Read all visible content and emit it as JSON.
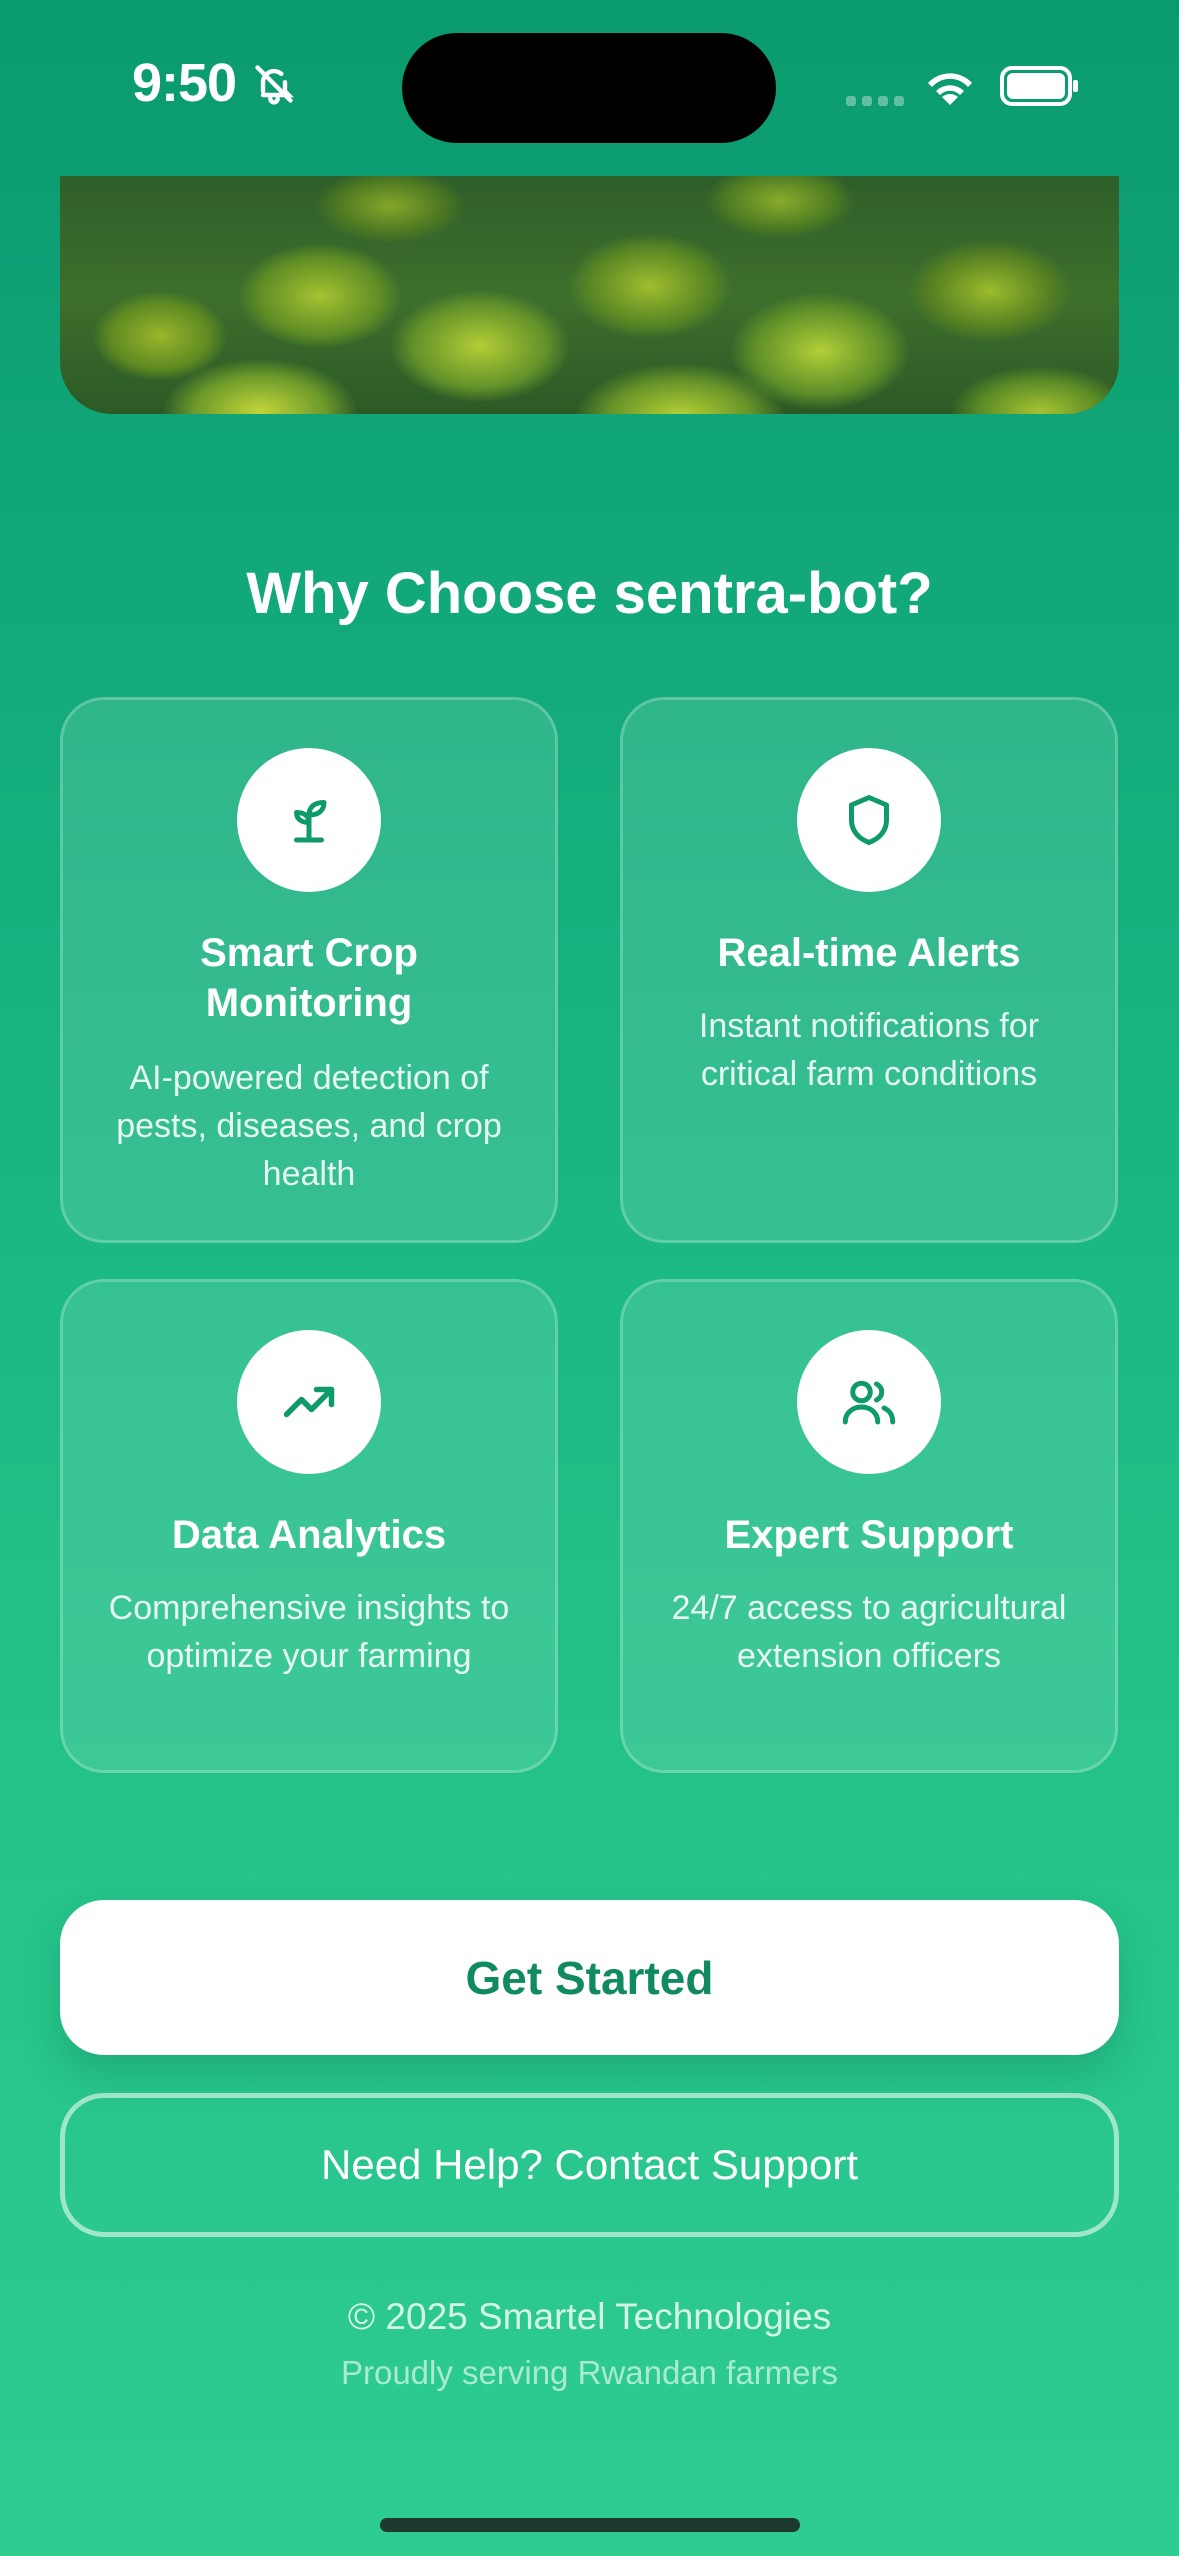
{
  "status_bar": {
    "time": "9:50"
  },
  "section_title": "Why Choose sentra-bot?",
  "features": [
    {
      "icon": "sprout-icon",
      "title": "Smart Crop Monitoring",
      "description": "AI-powered detection of pests, diseases, and crop health"
    },
    {
      "icon": "shield-icon",
      "title": "Real-time Alerts",
      "description": "Instant notifications for critical farm conditions"
    },
    {
      "icon": "trending-up-icon",
      "title": "Data Analytics",
      "description": "Comprehensive insights to optimize your farming"
    },
    {
      "icon": "users-icon",
      "title": "Expert Support",
      "description": "24/7 access to agricultural extension officers"
    }
  ],
  "actions": {
    "primary_label": "Get Started",
    "secondary_label": "Need Help? Contact Support"
  },
  "footer": {
    "copyright": "© 2025 Smartel Technologies",
    "tagline": "Proudly serving Rwandan farmers"
  },
  "colors": {
    "accent": "#0f8a61",
    "background_top": "#0a9a6f",
    "background_bottom": "#2fcc91"
  }
}
